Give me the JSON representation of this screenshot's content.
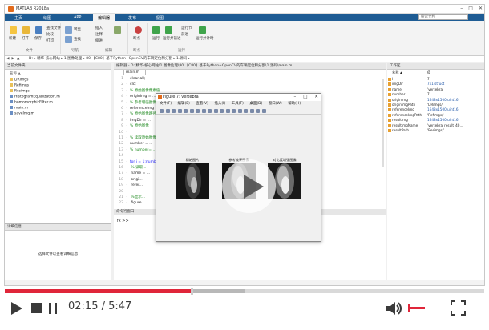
{
  "matlab": {
    "title": "MATLAB R2018a",
    "tabs": [
      "主页",
      "绘图",
      "APP",
      "编辑器",
      "发布",
      "视图"
    ],
    "active_tab": "编辑器",
    "search_placeholder": "搜索文档",
    "ribbon": {
      "new_label": "新建",
      "open_label": "打开",
      "save_label": "保存",
      "find_file_label": "查找文件",
      "compare_label": "比较",
      "print_label": "打印",
      "goto_label": "转至",
      "find_label": "查找",
      "insert_label": "插入",
      "comment_label": "注释",
      "indent_label": "缩进",
      "breakpoint_label": "断点",
      "run_label": "运行",
      "run_section_label": "运行并前进",
      "run_advance_label": "运行节",
      "advance_label": "前进",
      "run_time_label": "运行并计时",
      "group_file": "文件",
      "group_nav": "导航",
      "group_edit": "编辑",
      "group_bp": "断点",
      "group_run": "运行"
    },
    "address_path": "D: ▸ 精华-核心网站 ▸ 1.图像处理 ▸ 80.【C80】基于Python+OpenCV的车辆定位和分割 ▸ 1.源码 ▸",
    "current_folder_header": "当前文件夹",
    "file_list_header": "名称 ▲",
    "files": [
      "DRimgs",
      "Refimgs",
      "Resimgs",
      "HistogramEqualization.m",
      "homomorphicFilter.m",
      "main.m",
      "saveImg.m"
    ],
    "details_header": "详细信息",
    "details_text": "选择文件以查看详细信息",
    "editor_header": "编辑器 - D:\\精华-核心网站\\1.图像处理\\80.【C80】基于Python+OpenCV的车辆定位和分割\\1.源码\\main.m",
    "editor_tab": "main.m",
    "code_lines": [
      {
        "n": "1",
        "t": "clear all;",
        "c": "plain"
      },
      {
        "n": "2",
        "t": "clc;",
        "c": "plain"
      },
      {
        "n": "3",
        "t": "% 原始图像像素值",
        "c": "cmt"
      },
      {
        "n": "4",
        "t": "originImg = ...",
        "c": "plain"
      },
      {
        "n": "5",
        "t": "% 参考增强图像",
        "c": "cmt"
      },
      {
        "n": "6",
        "t": "referenceImg = ...",
        "c": "plain"
      },
      {
        "n": "7",
        "t": "% 原始图像路径",
        "c": "cmt"
      },
      {
        "n": "8",
        "t": "imgDir = ...",
        "c": "plain"
      },
      {
        "n": "9",
        "t": "% 原始图像",
        "c": "cmt"
      },
      {
        "n": "10",
        "t": "",
        "c": "plain"
      },
      {
        "n": "11",
        "t": "% 读取原始图像",
        "c": "cmt"
      },
      {
        "n": "12",
        "t": "number = ...",
        "c": "plain"
      },
      {
        "n": "13",
        "t": "% number=...",
        "c": "cmt"
      },
      {
        "n": "14",
        "t": "",
        "c": "plain"
      },
      {
        "n": "15",
        "t": "for i = 1:number",
        "c": "kw"
      },
      {
        "n": "16",
        "t": "    % 读取...",
        "c": "cmt"
      },
      {
        "n": "17",
        "t": "    name = ...",
        "c": "plain"
      },
      {
        "n": "18",
        "t": "    origi...",
        "c": "plain"
      },
      {
        "n": "19",
        "t": "    refer...",
        "c": "plain"
      },
      {
        "n": "20",
        "t": "",
        "c": "plain"
      },
      {
        "n": "21",
        "t": "    %显示...",
        "c": "cmt"
      },
      {
        "n": "22",
        "t": "    figure...",
        "c": "plain"
      }
    ],
    "command_window_header": "命令行窗口",
    "command_prompt": "fx >>",
    "workspace_header": "工作区",
    "workspace_col_name": "名称 ▲",
    "workspace_col_value": "值",
    "workspace_vars": [
      {
        "name": "i",
        "value": "7",
        "blue": false
      },
      {
        "name": "imgDir",
        "value": "7x1 struct",
        "blue": true
      },
      {
        "name": "name",
        "value": "'vertebra'",
        "blue": false
      },
      {
        "name": "number",
        "value": "7",
        "blue": false
      },
      {
        "name": "originImg",
        "value": "1643x1500 uint16",
        "blue": true
      },
      {
        "name": "originImgPath",
        "value": "'DRimgs/'",
        "blue": false
      },
      {
        "name": "referenceImg",
        "value": "1643x1500 uint16",
        "blue": true
      },
      {
        "name": "referenceImgPath",
        "value": "'Refimgs/'",
        "blue": false
      },
      {
        "name": "resultImg",
        "value": "1643x1500 uint16",
        "blue": true
      },
      {
        "name": "resultImgName",
        "value": "'vertebra_result_40...",
        "blue": false
      },
      {
        "name": "resultPath",
        "value": "'Resimgs/'",
        "blue": false
      }
    ]
  },
  "figure": {
    "title": "Figure 7: vertebra",
    "menu": [
      "文件(F)",
      "编辑(E)",
      "查看(V)",
      "插入(I)",
      "工具(T)",
      "桌面(D)",
      "窗口(W)",
      "帮助(H)"
    ],
    "subplot_titles": [
      "初始图片",
      "参考效果图像",
      "对比度增强图像"
    ]
  },
  "player": {
    "time_current": "02:15",
    "time_total": "5:47",
    "time_display": "02:15 / 5:47",
    "progress_fraction": 0.389,
    "buffered_fraction": 0.5,
    "volume_fraction": 0.12,
    "accent_color": "#e0263a",
    "icons": [
      "play-icon",
      "stop-icon",
      "pause-icon",
      "volume-icon",
      "fullscreen-icon",
      "big-play-icon"
    ]
  }
}
